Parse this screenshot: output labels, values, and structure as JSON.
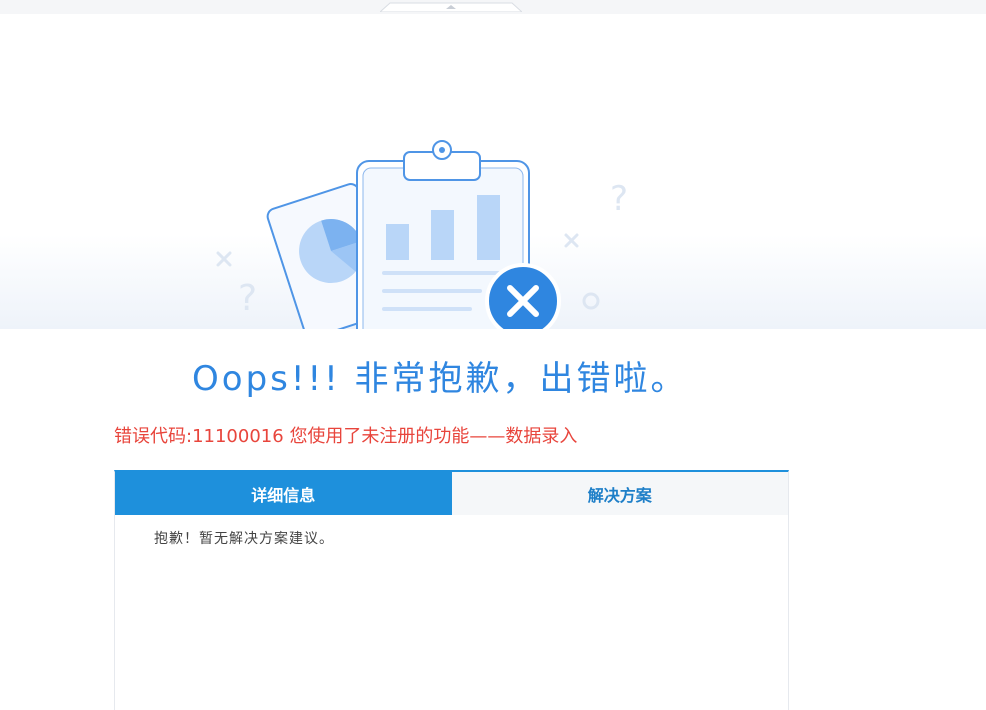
{
  "error": {
    "heading": "Oops!!! 非常抱歉，出错啦。",
    "code_label": "错误代码:",
    "code": "11100016",
    "message": "您使用了未注册的功能——数据录入"
  },
  "tabs": [
    {
      "label": "详细信息",
      "active": true
    },
    {
      "label": "解决方案",
      "active": false
    }
  ],
  "panel": {
    "content": "抱歉！暂无解决方案建议。"
  },
  "colors": {
    "accent": "#1e90dc",
    "heading": "#2f86e0",
    "error_text": "#e8453c",
    "close_badge": "#2f86e0"
  },
  "icons": {
    "illustration": "clipboard-chart-error-illustration",
    "badge": "close-icon"
  }
}
